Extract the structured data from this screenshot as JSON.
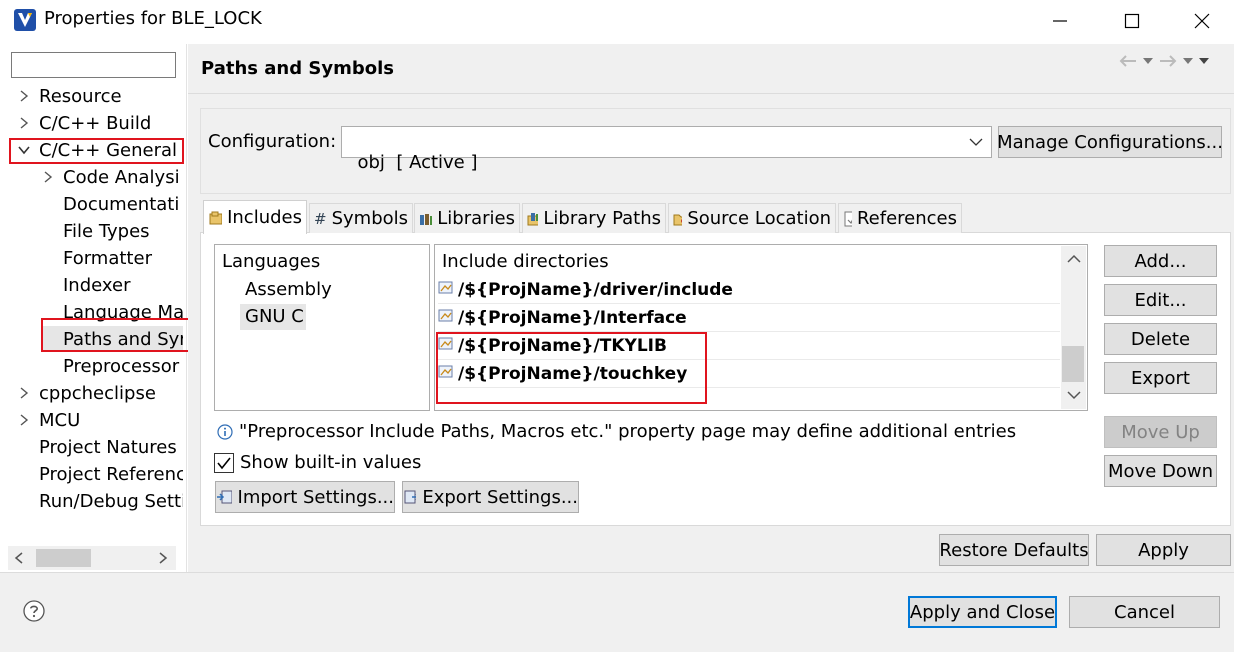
{
  "window": {
    "title": "Properties for BLE_LOCK",
    "minimize_icon": "minimize-icon",
    "maximize_icon": "maximize-icon",
    "close_icon": "close-icon"
  },
  "tree": {
    "filter_placeholder": "",
    "items": [
      {
        "label": "Resource",
        "chevron": "right"
      },
      {
        "label": "C/C++ Build",
        "chevron": "right"
      },
      {
        "label": "C/C++ General",
        "chevron": "down"
      },
      {
        "label": "Code Analysi",
        "chevron": "right"
      },
      {
        "label": "Documentati",
        "chevron": ""
      },
      {
        "label": "File Types",
        "chevron": ""
      },
      {
        "label": "Formatter",
        "chevron": ""
      },
      {
        "label": "Indexer",
        "chevron": ""
      },
      {
        "label": "Language Ma",
        "chevron": ""
      },
      {
        "label": "Paths and Syr",
        "chevron": ""
      },
      {
        "label": "Preprocessor",
        "chevron": ""
      },
      {
        "label": "cppcheclipse",
        "chevron": "right"
      },
      {
        "label": "MCU",
        "chevron": "right"
      },
      {
        "label": "Project Natures",
        "chevron": ""
      },
      {
        "label": "Project Referenc",
        "chevron": ""
      },
      {
        "label": "Run/Debug Setti",
        "chevron": ""
      }
    ]
  },
  "page": {
    "title": "Paths and Symbols"
  },
  "config": {
    "label": "Configuration:",
    "value": "obj  [ Active ]",
    "manage_label": "Manage Configurations..."
  },
  "tabs": [
    {
      "label": "Includes",
      "icon": "includes-icon"
    },
    {
      "label": "Symbols",
      "icon": "hash-icon",
      "glyph": "#"
    },
    {
      "label": "Libraries",
      "icon": "libraries-icon"
    },
    {
      "label": "Library Paths",
      "icon": "library-paths-icon"
    },
    {
      "label": "Source Location",
      "icon": "folder-icon"
    },
    {
      "label": "References",
      "icon": "references-icon"
    }
  ],
  "languages": {
    "header": "Languages",
    "items": [
      "Assembly",
      "GNU C"
    ]
  },
  "includes": {
    "header": "Include directories",
    "items": [
      "/${ProjName}/driver/include",
      "/${ProjName}/Interface",
      "/${ProjName}/TKYLIB",
      "/${ProjName}/touchkey"
    ]
  },
  "side_buttons": {
    "add": "Add...",
    "edit": "Edit...",
    "delete": "Delete",
    "export": "Export",
    "move_up": "Move Up",
    "move_down": "Move Down"
  },
  "info_text": "\"Preprocessor Include Paths, Macros etc.\" property page may define additional entries",
  "show_builtin": {
    "label": "Show built-in values",
    "checked": true
  },
  "import_settings": "Import Settings...",
  "export_settings": "Export Settings...",
  "restore_defaults": "Restore Defaults",
  "apply": "Apply",
  "apply_and_close": "Apply and Close",
  "cancel": "Cancel",
  "colors": {
    "highlight_red": "#e0141e",
    "default_button_border": "#0078d7"
  }
}
